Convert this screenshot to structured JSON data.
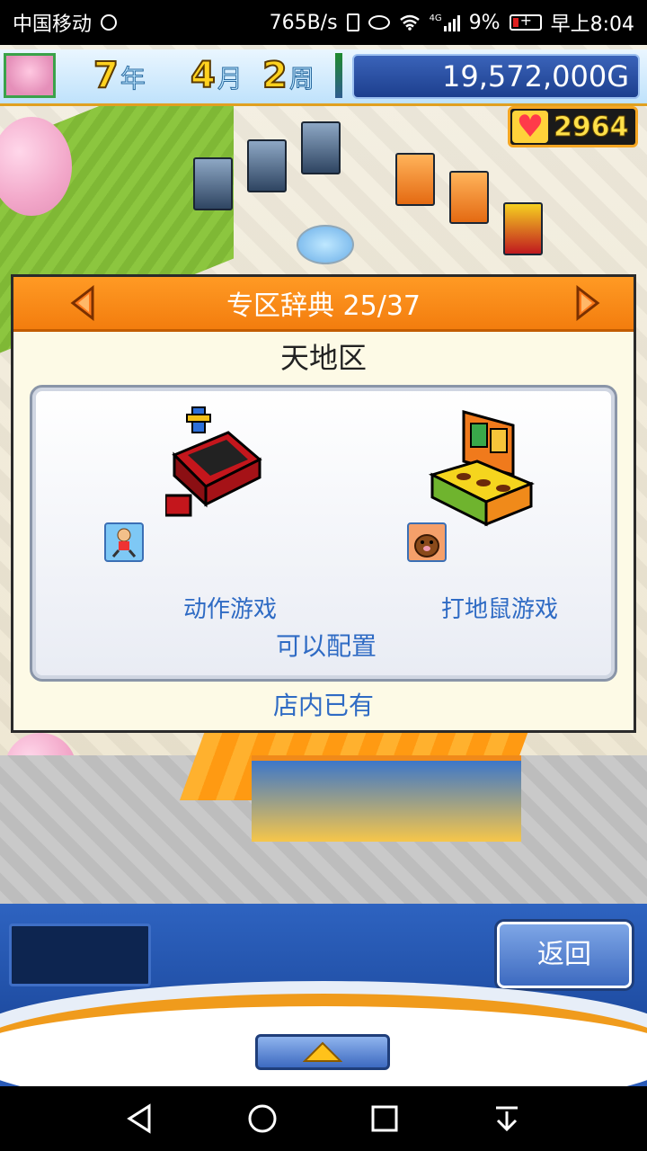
{
  "status_bar": {
    "carrier": "中国移动",
    "speed": "765B/s",
    "network": "4G",
    "battery": "9%",
    "time": "早上8:04"
  },
  "hud": {
    "year_num": "7",
    "year_unit": "年",
    "month_num": "4",
    "month_unit": "月",
    "week_num": "2",
    "week_unit": "周",
    "money": "19,572,000G",
    "hearts": "2964"
  },
  "dialog": {
    "header_title": "专区辞典 25/37",
    "zone_name": "天地区",
    "items": [
      {
        "label": "动作游戏",
        "icon": "action-game-cabinet-icon",
        "badge_icon": "running-kid-icon"
      },
      {
        "label": "打地鼠游戏",
        "icon": "whack-a-mole-machine-icon",
        "badge_icon": "mole-icon"
      }
    ],
    "can_place": "可以配置",
    "owned_status": "店内已有"
  },
  "bottom": {
    "back_label": "返回",
    "expand_icon": "triangle-up-icon"
  },
  "colors": {
    "header_orange": "#f37d0e",
    "link_blue": "#2f6bc4",
    "panel_blue": "#1f4da3"
  }
}
